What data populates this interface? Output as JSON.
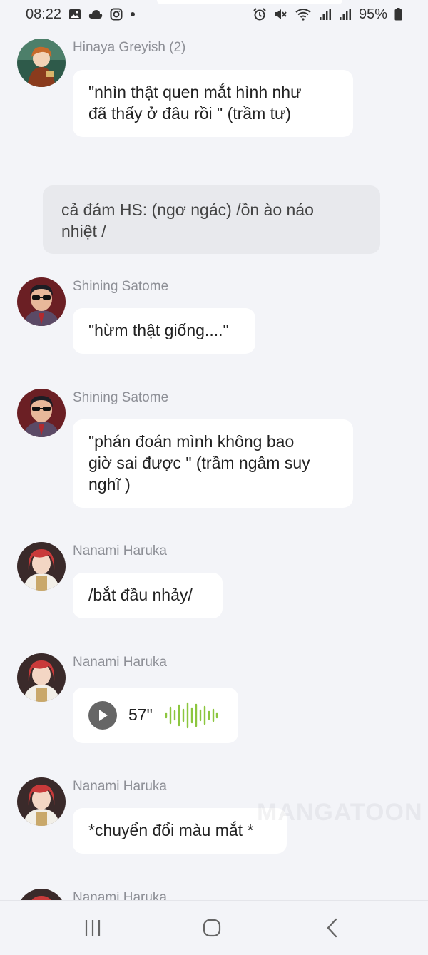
{
  "status_bar": {
    "time": "08:22",
    "battery": "95%"
  },
  "messages": [
    {
      "sender": "Hinaya Greyish (2)",
      "text": "\"nhìn thật quen mắt hình như\nđã thấy ở đâu rồi \" (trầm tư)"
    },
    {
      "sender": "Shining Satome",
      "text": "\"hừm thật giống....\""
    },
    {
      "sender": "Shining Satome",
      "text": "\"phán đoán mình không bao\ngiờ sai được \" (trầm ngâm suy\nnghĩ )"
    },
    {
      "sender": "Nanami Haruka",
      "text": "/bắt đầu nhảy/"
    },
    {
      "sender": "Nanami Haruka",
      "voice_duration": "57\""
    },
    {
      "sender": "Nanami Haruka",
      "text": "*chuyển đổi màu mắt *"
    },
    {
      "sender": "Nanami Haruka"
    }
  ],
  "narration": "cả đám HS: (ngơ ngác) /ồn ào náo\nnhiệt /",
  "watermark": "MANGATOON",
  "colors": {
    "background": "#f3f4f8",
    "bubble": "#ffffff",
    "narration_bubble": "#e8e9ed",
    "sender_name": "#8d8f96",
    "waveform": "#8cc63f"
  },
  "icons": [
    "gallery-icon",
    "cloud-icon",
    "instagram-icon",
    "alarm-icon",
    "mute-icon",
    "wifi-icon",
    "signal-icon",
    "battery-icon",
    "play-icon",
    "recents-icon",
    "home-icon",
    "back-icon"
  ]
}
